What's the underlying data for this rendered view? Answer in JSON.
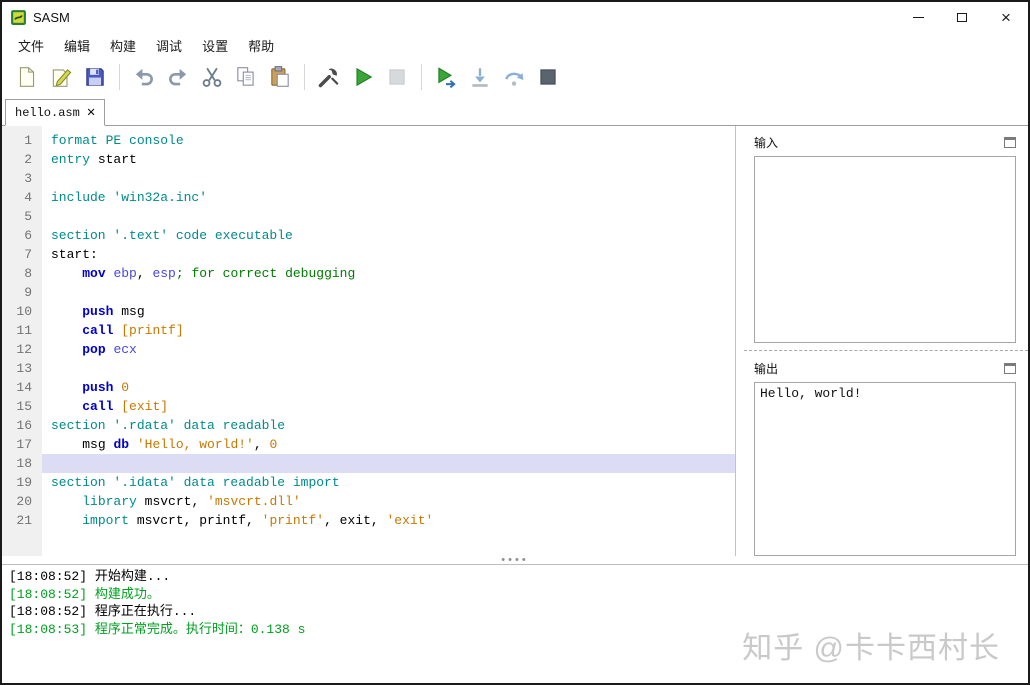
{
  "window": {
    "title": "SASM"
  },
  "menu": {
    "items": [
      {
        "label": "文件",
        "name": "file"
      },
      {
        "label": "编辑",
        "name": "edit"
      },
      {
        "label": "构建",
        "name": "build"
      },
      {
        "label": "调试",
        "name": "debug"
      },
      {
        "label": "设置",
        "name": "settings"
      },
      {
        "label": "帮助",
        "name": "help"
      }
    ]
  },
  "toolbar": {
    "buttons": [
      "new-file",
      "open-file",
      "save",
      "|",
      "undo",
      "redo",
      "cut",
      "copy",
      "paste",
      "|",
      "build",
      "run",
      "stop",
      "|",
      "debug",
      "step-into",
      "step-over",
      "debug-stop"
    ],
    "disabled": [
      "stop",
      "step-into",
      "step-over"
    ]
  },
  "tabs": [
    {
      "label": "hello.asm",
      "close": "✕"
    }
  ],
  "editor": {
    "current_line": 18,
    "lines": [
      [
        {
          "t": "format PE console",
          "c": "kw"
        }
      ],
      [
        {
          "t": "entry ",
          "c": "kw"
        },
        {
          "t": "start",
          "c": "p"
        }
      ],
      [],
      [
        {
          "t": "include 'win32a.inc'",
          "c": "kw"
        }
      ],
      [],
      [
        {
          "t": "section '.text' code executable",
          "c": "kw"
        }
      ],
      [
        {
          "t": "start:",
          "c": "p"
        }
      ],
      [
        {
          "t": "    ",
          "c": "p"
        },
        {
          "t": "mov ",
          "c": "ins"
        },
        {
          "t": "ebp",
          "c": "reg"
        },
        {
          "t": ", ",
          "c": "p"
        },
        {
          "t": "esp",
          "c": "reg"
        },
        {
          "t": "; for correct debugging",
          "c": "cmt"
        }
      ],
      [],
      [
        {
          "t": "    ",
          "c": "p"
        },
        {
          "t": "push ",
          "c": "ins"
        },
        {
          "t": "msg",
          "c": "p"
        }
      ],
      [
        {
          "t": "    ",
          "c": "p"
        },
        {
          "t": "call ",
          "c": "ins"
        },
        {
          "t": "[printf]",
          "c": "num"
        }
      ],
      [
        {
          "t": "    ",
          "c": "p"
        },
        {
          "t": "pop ",
          "c": "ins"
        },
        {
          "t": "ecx",
          "c": "reg"
        }
      ],
      [],
      [
        {
          "t": "    ",
          "c": "p"
        },
        {
          "t": "push ",
          "c": "ins"
        },
        {
          "t": "0",
          "c": "num"
        }
      ],
      [
        {
          "t": "    ",
          "c": "p"
        },
        {
          "t": "call ",
          "c": "ins"
        },
        {
          "t": "[exit]",
          "c": "num"
        }
      ],
      [
        {
          "t": "section '.rdata' data readable",
          "c": "kw"
        }
      ],
      [
        {
          "t": "    ",
          "c": "p"
        },
        {
          "t": "msg ",
          "c": "p"
        },
        {
          "t": "db ",
          "c": "ins"
        },
        {
          "t": "'Hello, world!'",
          "c": "str"
        },
        {
          "t": ", ",
          "c": "p"
        },
        {
          "t": "0",
          "c": "num"
        }
      ],
      [],
      [
        {
          "t": "section '.idata' data readable import",
          "c": "kw"
        }
      ],
      [
        {
          "t": "    ",
          "c": "p"
        },
        {
          "t": "library ",
          "c": "kw"
        },
        {
          "t": "msvcrt",
          "c": "p"
        },
        {
          "t": ", ",
          "c": "p"
        },
        {
          "t": "'msvcrt.dll'",
          "c": "str"
        }
      ],
      [
        {
          "t": "    ",
          "c": "p"
        },
        {
          "t": "import ",
          "c": "kw"
        },
        {
          "t": "msvcrt, printf, ",
          "c": "p"
        },
        {
          "t": "'printf'",
          "c": "str"
        },
        {
          "t": ", exit, ",
          "c": "p"
        },
        {
          "t": "'exit'",
          "c": "str"
        }
      ]
    ]
  },
  "panels": {
    "input": {
      "label": "输入",
      "value": ""
    },
    "output": {
      "label": "输出",
      "value": "Hello, world!"
    }
  },
  "log": {
    "lines": [
      {
        "text": "[18:08:52] 开始构建...",
        "ok": false
      },
      {
        "text": "[18:08:52] 构建成功。",
        "ok": true
      },
      {
        "text": "[18:08:52] 程序正在执行...",
        "ok": false
      },
      {
        "text": "[18:08:53] 程序正常完成。执行时间：0.138 s",
        "ok": true
      }
    ]
  },
  "watermark": {
    "text": "知乎 @卡卡西村长"
  },
  "colors": {
    "kw": "#008b8b",
    "ins": "#0000cc",
    "reg": "#4848d8",
    "num": "#c87800",
    "str": "#c87800",
    "cmt": "#007d00",
    "plain": "#000000",
    "ok": "#00a020",
    "curline": "#dcdcf5",
    "watermark": "#c9c9c9"
  }
}
